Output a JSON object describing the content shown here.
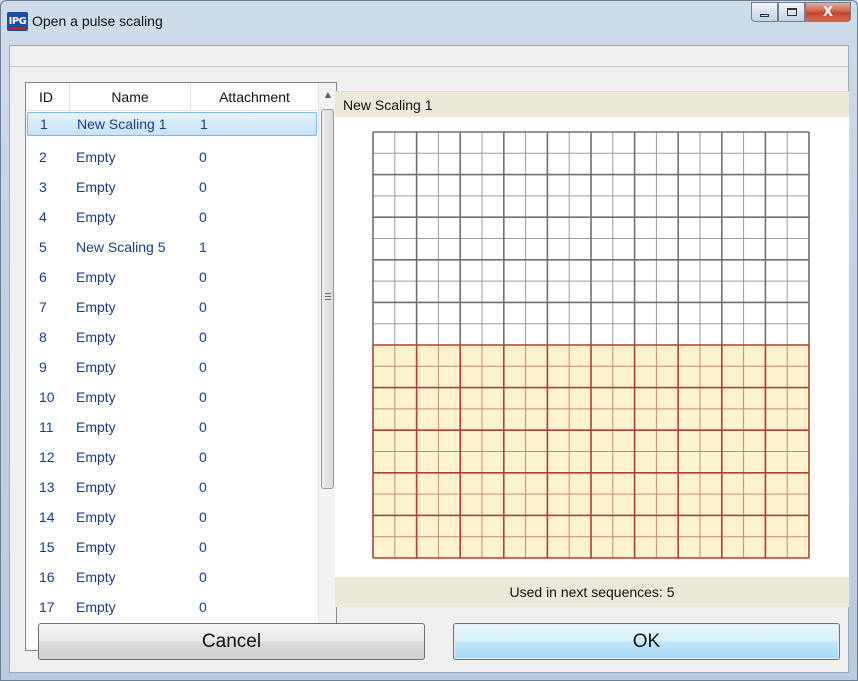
{
  "window": {
    "title": "Open a pulse scaling",
    "logo_text": "IPG",
    "close_glyph": "X"
  },
  "list": {
    "headers": {
      "id": "ID",
      "name": "Name",
      "attachment": "Attachment"
    },
    "rows": [
      {
        "id": "1",
        "name": "New Scaling 1",
        "attachment": "1",
        "selected": true
      },
      {
        "id": "2",
        "name": "Empty",
        "attachment": "0"
      },
      {
        "id": "3",
        "name": "Empty",
        "attachment": "0"
      },
      {
        "id": "4",
        "name": "Empty",
        "attachment": "0"
      },
      {
        "id": "5",
        "name": "New Scaling 5",
        "attachment": "1"
      },
      {
        "id": "6",
        "name": "Empty",
        "attachment": "0"
      },
      {
        "id": "7",
        "name": "Empty",
        "attachment": "0"
      },
      {
        "id": "8",
        "name": "Empty",
        "attachment": "0"
      },
      {
        "id": "9",
        "name": "Empty",
        "attachment": "0"
      },
      {
        "id": "10",
        "name": "Empty",
        "attachment": "0"
      },
      {
        "id": "11",
        "name": "Empty",
        "attachment": "0"
      },
      {
        "id": "12",
        "name": "Empty",
        "attachment": "0"
      },
      {
        "id": "13",
        "name": "Empty",
        "attachment": "0"
      },
      {
        "id": "14",
        "name": "Empty",
        "attachment": "0"
      },
      {
        "id": "15",
        "name": "Empty",
        "attachment": "0"
      },
      {
        "id": "16",
        "name": "Empty",
        "attachment": "0"
      },
      {
        "id": "17",
        "name": "Empty",
        "attachment": "0"
      }
    ]
  },
  "preview": {
    "title": "New Scaling 1",
    "usage_text": "Used in next sequences: 5",
    "grid": {
      "major_cols": 10,
      "major_rows": 10,
      "filled_rows_from_bottom": 5,
      "fill_color": "#fdf4cf",
      "fill_border_color": "#b04030",
      "empty_border_color": "#707070"
    }
  },
  "buttons": {
    "cancel_label": "Cancel",
    "ok_label": "OK"
  },
  "colors": {
    "accent": "#3c7fb1",
    "list_text": "#1a3a8c",
    "header_band": "#ece9d8"
  }
}
